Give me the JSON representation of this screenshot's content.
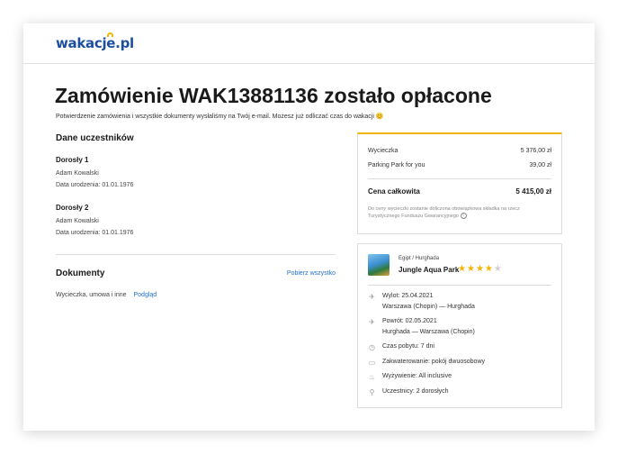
{
  "header": {
    "logo_text": "wakacje.pl"
  },
  "page": {
    "title": "Zamówienie WAK13881136 zostało opłacone",
    "subtitle": "Potwierdzenie zamówienia i wszystkie dokumenty wysłaliśmy na Twój e-mail. Możesz już odliczać czas do wakacji 😊"
  },
  "participants": {
    "title": "Dane uczestników",
    "people": [
      {
        "label": "Dorosły 1",
        "name": "Adam Kowalski",
        "birth": "Data urodzenia: 01.01.1976"
      },
      {
        "label": "Dorosły 2",
        "name": "Adam Kowalski",
        "birth": "Data urodzenia: 01.01.1976"
      }
    ]
  },
  "documents": {
    "title": "Dokumenty",
    "download_label": "Pobierz wszystko",
    "item_label": "Wycieczka, umowa i inne",
    "preview_label": "Podgląd"
  },
  "price": {
    "rows": [
      {
        "label": "Wycieczka",
        "value": "5 376,00 zł"
      },
      {
        "label": "Parking Park for you",
        "value": "39,00 zł"
      }
    ],
    "total_label": "Cena całkowita",
    "total_value": "5 415,00 zł",
    "note": "Do ceny wycieczki zostanie doliczona obowiązkowa składka na rzecz Turystycznego Funduszu Gwarancyjnego"
  },
  "trip": {
    "location": "Egipt  /  Hurghada",
    "hotel": "Jungle Aqua Park",
    "stars": 4,
    "stars_max": 5,
    "departure_label": "Wylot: 25.04.2021",
    "departure_route": "Warszawa (Chopin) — Hurghada",
    "return_label": "Powrót: 02.05.2021",
    "return_route": "Hurghada — Warszawa (Chopin)",
    "duration": "Czas pobytu: 7 dni",
    "accommodation": "Zakwaterowanie: pokój dwuosobowy",
    "board": "Wyżywienie: All inclusive",
    "participants": "Uczestnicy: 2 dorosłych"
  },
  "colors": {
    "brand": "#1d4fa0",
    "accent": "#f5b400",
    "link": "#1d6fd1"
  },
  "icons": [
    "plane-departure-icon",
    "plane-arrival-icon",
    "clock-icon",
    "bed-icon",
    "food-icon",
    "person-icon",
    "info-icon"
  ]
}
